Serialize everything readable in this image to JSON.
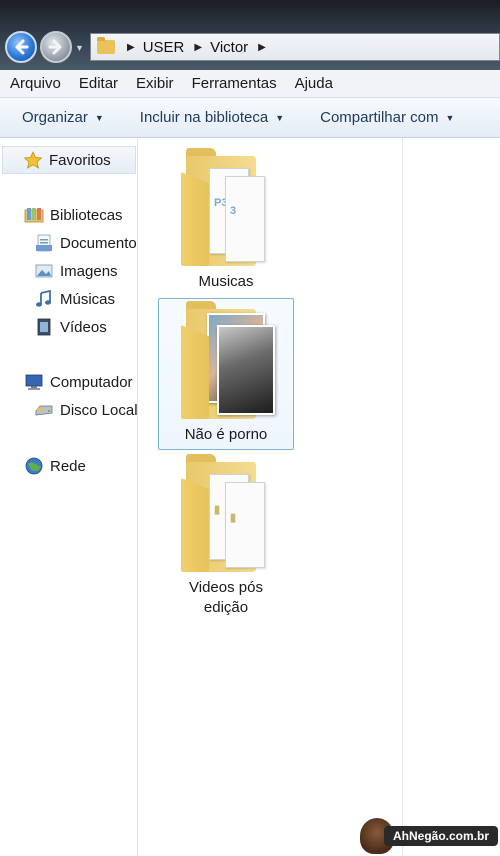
{
  "address_bar": {
    "crumbs": [
      "USER",
      "Victor"
    ]
  },
  "menu": {
    "items": [
      "Arquivo",
      "Editar",
      "Exibir",
      "Ferramentas",
      "Ajuda"
    ]
  },
  "toolbar": {
    "organize_label": "Organizar",
    "include_label": "Incluir na biblioteca",
    "share_label": "Compartilhar com"
  },
  "nav_pane": {
    "favorites_label": "Favoritos",
    "libraries_label": "Bibliotecas",
    "libraries": [
      "Documentos",
      "Imagens",
      "Músicas",
      "Vídeos"
    ],
    "computer_label": "Computador",
    "local_disk_label": "Disco Local",
    "network_label": "Rede"
  },
  "folders": [
    {
      "name": "Musicas",
      "selected": false,
      "preview": "mp3-docs"
    },
    {
      "name": "Não é porno",
      "selected": true,
      "preview": "photos"
    },
    {
      "name": "Videos pós edição",
      "selected": false,
      "preview": "video-docs"
    }
  ],
  "watermark": {
    "text": "AhNegão.com.br"
  },
  "colors": {
    "folder": "#e9c86b",
    "toolbar_text": "#1e395b",
    "selection_border": "#7fb1d9"
  }
}
